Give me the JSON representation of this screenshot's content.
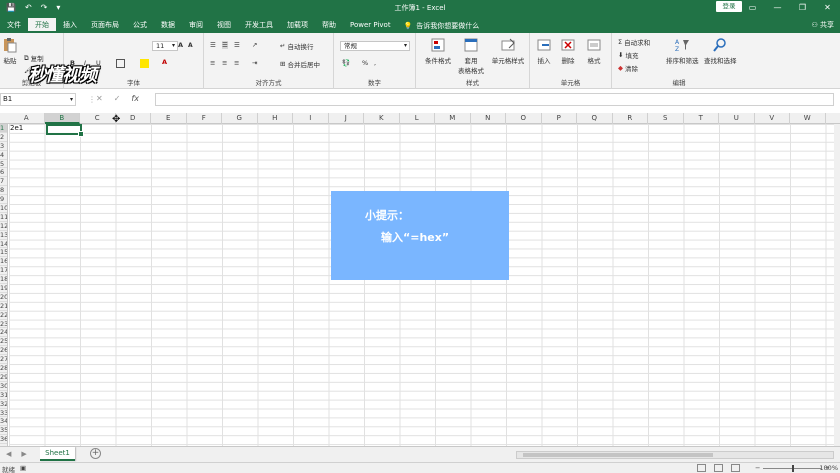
{
  "titlebar": {
    "qat": [
      "💾",
      "↶",
      "↷",
      "▾"
    ],
    "title": "工作簿1  -  Excel",
    "login": "登录",
    "window_buttons": [
      "▭",
      "—",
      "❐",
      "✕"
    ]
  },
  "tabs": [
    "文件",
    "开始",
    "插入",
    "页面布局",
    "公式",
    "数据",
    "审阅",
    "视图",
    "开发工具",
    "加载项",
    "帮助",
    "Power Pivot"
  ],
  "active_tab": "开始",
  "tell_me": "告诉我你想要做什么",
  "share": "共享",
  "ribbon": {
    "clipboard": {
      "paste": "粘贴",
      "cut": "剪切",
      "copy": "复制",
      "format_painter": "格式刷",
      "label": "剪贴板"
    },
    "font": {
      "font_name": "等线",
      "font_size": "11",
      "grow": "A",
      "shrink": "A",
      "bold": "B",
      "italic": "I",
      "underline": "U",
      "label": "字体"
    },
    "alignment": {
      "wrap": "自动换行",
      "merge": "合并后居中",
      "label": "对齐方式"
    },
    "number": {
      "format": "常规",
      "percent": "%",
      "comma": ",",
      "label": "数字"
    },
    "styles": {
      "conditional": "条件格式",
      "table": "套用\n表格格式",
      "cell_styles": "单元格样式",
      "label": "样式"
    },
    "cells": {
      "insert": "插入",
      "delete": "删除",
      "format": "格式",
      "label": "单元格"
    },
    "editing": {
      "autosum": "自动求和",
      "fill": "填充",
      "clear": "清除",
      "sort": "排序和筛选",
      "find": "查找和选择",
      "label": "编辑"
    }
  },
  "watermark": "秒懂视频",
  "formula_bar": {
    "name_box": "B1",
    "cancel": "✕",
    "enter": "✓",
    "fx": "fx",
    "value": ""
  },
  "columns": [
    "A",
    "B",
    "C",
    "D",
    "E",
    "F",
    "G",
    "H",
    "I",
    "J",
    "K",
    "L",
    "M",
    "N",
    "O",
    "P",
    "Q",
    "R",
    "S",
    "T",
    "U",
    "V",
    "W"
  ],
  "selected_column": "B",
  "rows": [
    "1",
    "2",
    "3",
    "4",
    "5",
    "6",
    "7",
    "8",
    "9",
    "10",
    "11",
    "12",
    "13",
    "14",
    "15",
    "16",
    "17",
    "18",
    "19",
    "20",
    "21",
    "22",
    "23",
    "24",
    "25",
    "26",
    "27",
    "28",
    "29",
    "30",
    "31",
    "32",
    "33",
    "34",
    "35",
    "36"
  ],
  "cell_a1": "2e1",
  "hint": {
    "title": "小提示：",
    "body": "输入“=hex”"
  },
  "sheet_tab": "Sheet1",
  "status": {
    "ready": "就绪",
    "zoom": "100%"
  },
  "colors": {
    "excel_green": "#217346",
    "hint_blue": "#7ab6ff"
  }
}
